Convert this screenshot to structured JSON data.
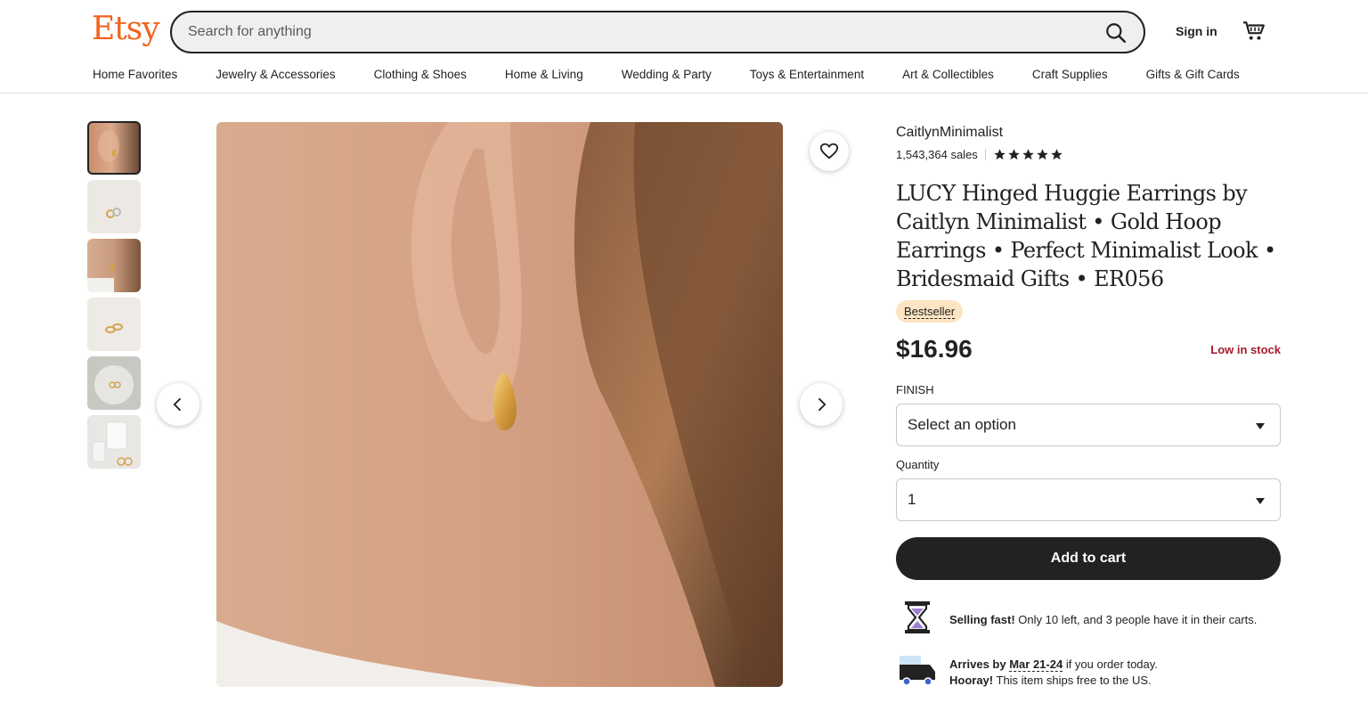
{
  "header": {
    "logo": "Etsy",
    "search_placeholder": "Search for anything",
    "signin_label": "Sign in"
  },
  "nav": [
    "Home Favorites",
    "Jewelry & Accessories",
    "Clothing & Shoes",
    "Home & Living",
    "Wedding & Party",
    "Toys & Entertainment",
    "Art & Collectibles",
    "Craft Supplies",
    "Gifts & Gift Cards"
  ],
  "listing": {
    "shop_name": "CaitlynMinimalist",
    "sales": "1,543,364 sales",
    "rating_stars": 5,
    "title": "LUCY Hinged Huggie Earrings by Caitlyn Minimalist • Gold Hoop Earrings • Perfect Minimalist Look • Bridesmaid Gifts • ER056",
    "badge": "Bestseller",
    "price": "$16.96",
    "stock": "Low in stock",
    "finish_label": "FINISH",
    "finish_value": "Select an option",
    "quantity_label": "Quantity",
    "quantity_value": "1",
    "add_to_cart": "Add to cart",
    "selling_fast_bold": "Selling fast!",
    "selling_fast_text": " Only 10 left, and 3 people have it in their carts.",
    "arrives_bold": "Arrives by",
    "arrives_date": "Mar 21-24",
    "arrives_text": " if you order today.",
    "hooray_bold": "Hooray!",
    "hooray_text": " This item ships free to the US."
  },
  "colors": {
    "brand": "#f1641e",
    "stock": "#a61a2e",
    "badge_bg": "#fde4c2"
  }
}
